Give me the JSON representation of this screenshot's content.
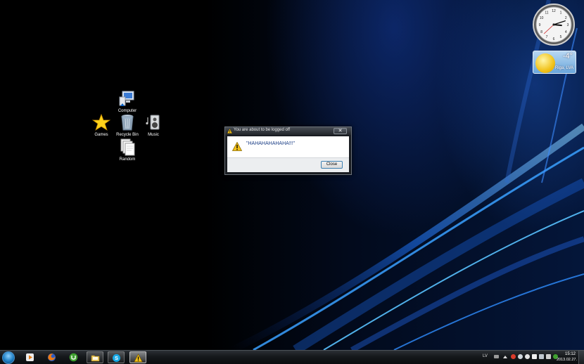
{
  "desktop": {
    "icons": [
      {
        "label": "Computer",
        "icon": "computer-icon"
      },
      {
        "label": "Games",
        "icon": "games-star-icon"
      },
      {
        "label": "Recycle Bin",
        "icon": "recycle-bin-icon"
      },
      {
        "label": "Music",
        "icon": "music-speaker-icon"
      },
      {
        "label": "Random",
        "icon": "folder-documents-icon"
      }
    ]
  },
  "gadgets": {
    "clock": {
      "hour": 3,
      "minute": 12,
      "icon": "analog-clock-icon"
    },
    "weather": {
      "temperature": "-4°",
      "location": "Riga, LVA",
      "icon": "sun-icon"
    }
  },
  "dialog": {
    "title": "You are about to be logged off",
    "message": "\"HAHAHAHAHAHA!!!\"",
    "button_label": "Close",
    "icon": "warning-icon"
  },
  "taskbar": {
    "start_icon": "windows-start-orb-icon",
    "buttons": [
      {
        "icon": "media-player-icon",
        "state": "pinned"
      },
      {
        "icon": "firefox-icon",
        "state": "pinned"
      },
      {
        "icon": "utorrent-icon",
        "state": "pinned"
      },
      {
        "icon": "folder-explorer-icon",
        "state": "open"
      },
      {
        "icon": "skype-icon",
        "state": "open"
      },
      {
        "icon": "warning-icon",
        "state": "active"
      }
    ],
    "tray": {
      "language": "LV",
      "time": "15:12",
      "date": "2013.02.27."
    }
  },
  "colors": {
    "accent_blue": "#1e6fd9",
    "dialog_message": "#1b3e86",
    "warning_yellow": "#f3c21a"
  }
}
